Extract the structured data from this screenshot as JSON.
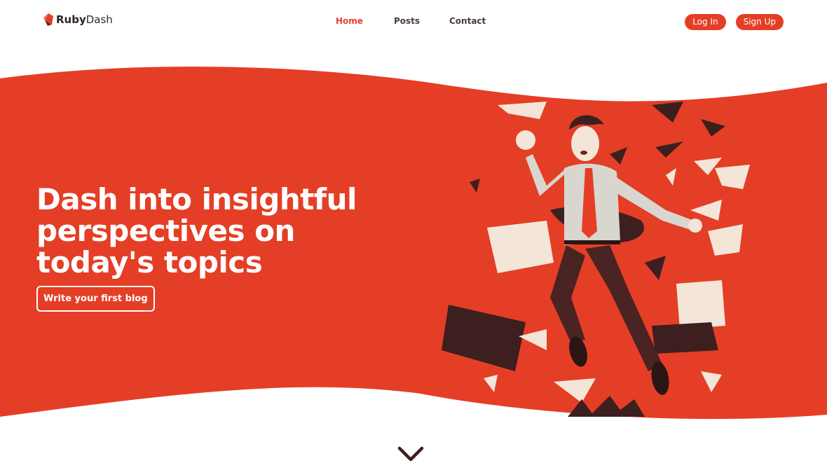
{
  "brand": {
    "name_bold": "Ruby",
    "name_light": "Dash",
    "logo_icon": "ruby-gem-icon"
  },
  "nav": {
    "items": [
      {
        "label": "Home",
        "active": true
      },
      {
        "label": "Posts",
        "active": false
      },
      {
        "label": "Contact",
        "active": false
      }
    ]
  },
  "auth": {
    "login_label": "Log In",
    "signup_label": "Sign Up"
  },
  "hero": {
    "headline_lines": [
      "Dash into insightful",
      "perspectives on",
      "today's topics"
    ],
    "cta_label": "Write your first blog",
    "illustration": "man-jumping-with-flying-papers-illustration"
  },
  "scroll_icon": "chevron-down-icon",
  "colors": {
    "accent": "#e53e26",
    "dark": "#3d1f1f",
    "paper": "#f3e6d8",
    "text_dark": "#2b1f1f"
  }
}
